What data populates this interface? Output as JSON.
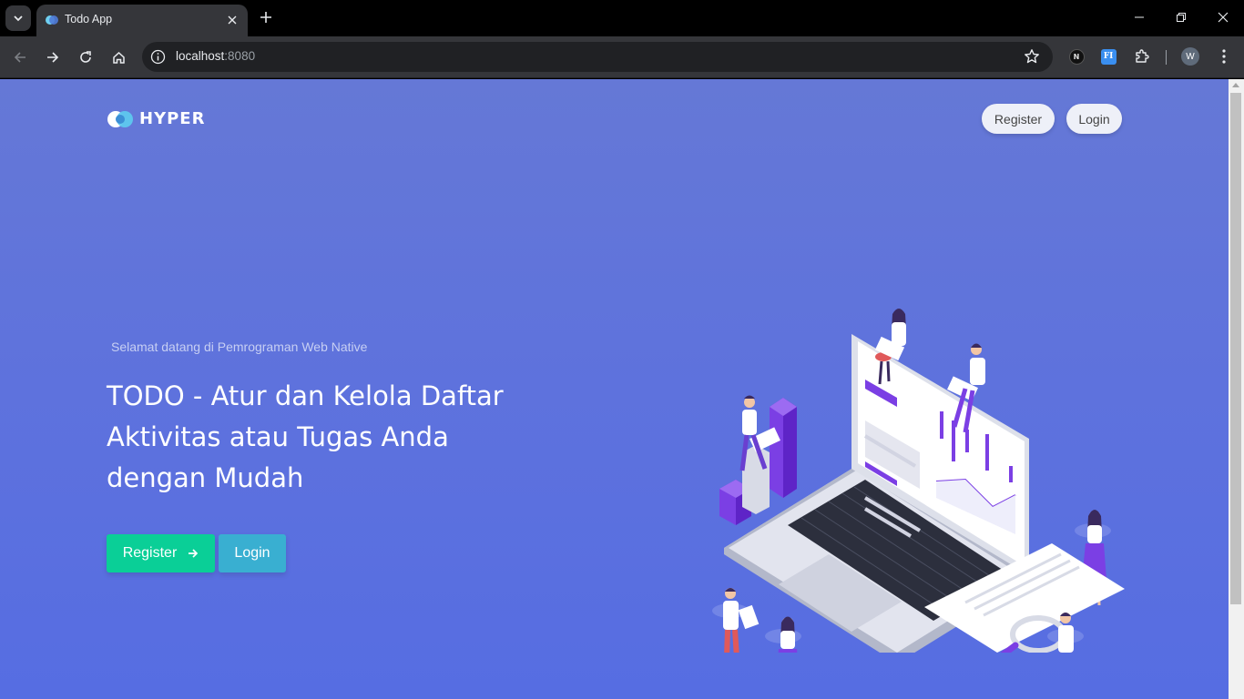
{
  "browser": {
    "tab_title": "Todo App",
    "url_host": "localhost",
    "url_port": ":8080",
    "profile_initial": "W",
    "ext_n_label": "N",
    "ext_fi_label": "FI"
  },
  "header": {
    "logo_text": "HYPER",
    "register_label": "Register",
    "login_label": "Login"
  },
  "hero": {
    "welcome": "Selamat datang di Pemrograman Web Native",
    "headline": "TODO - Atur dan Kelola Daftar Aktivitas atau Tugas Anda dengan Mudah",
    "register_button": "Register",
    "login_button": "Login"
  },
  "colors": {
    "page_gradient": [
      "#6578d6",
      "#566de2"
    ],
    "success": "#0acf97",
    "info": "#39afd1",
    "accent_purple": "#7b3fe4"
  },
  "icons": [
    "tab-search-icon",
    "favicon-icon",
    "close-icon",
    "plus-icon",
    "minimize-icon",
    "restore-icon",
    "back-icon",
    "forward-icon",
    "reload-icon",
    "home-icon",
    "info-icon",
    "star-icon",
    "extensions-icon",
    "more-icon",
    "arrow-right-icon"
  ]
}
